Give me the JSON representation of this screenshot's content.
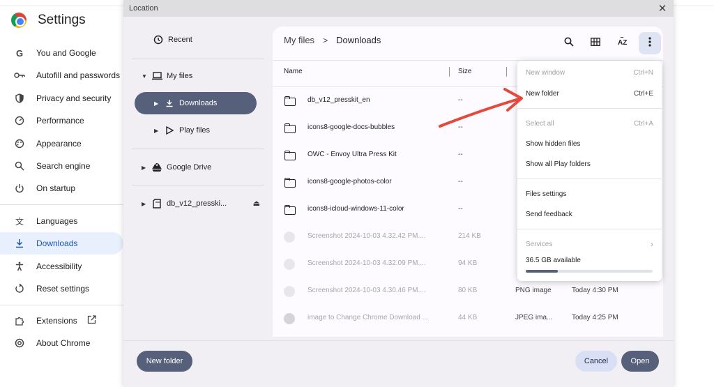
{
  "settings": {
    "title": "Settings",
    "nav": [
      {
        "label": "You and Google",
        "icon": "google-g-icon"
      },
      {
        "label": "Autofill and passwords",
        "icon": "key-icon"
      },
      {
        "label": "Privacy and security",
        "icon": "shield-icon"
      },
      {
        "label": "Performance",
        "icon": "speedometer-icon"
      },
      {
        "label": "Appearance",
        "icon": "palette-icon"
      },
      {
        "label": "Search engine",
        "icon": "search-icon"
      },
      {
        "label": "On startup",
        "icon": "power-icon"
      },
      {
        "label": "Languages",
        "icon": "translate-icon"
      },
      {
        "label": "Downloads",
        "icon": "download-icon"
      },
      {
        "label": "Accessibility",
        "icon": "accessibility-icon"
      },
      {
        "label": "Reset settings",
        "icon": "reset-icon"
      },
      {
        "label": "Extensions",
        "icon": "puzzle-icon"
      },
      {
        "label": "About Chrome",
        "icon": "chrome-icon"
      }
    ],
    "active_item": "Downloads"
  },
  "dialog": {
    "title": "Location",
    "sidebar": {
      "recent": "Recent",
      "my_files": "My files",
      "downloads": "Downloads",
      "play_files": "Play files",
      "google_drive": "Google Drive",
      "usb_drive": "db_v12_presski..."
    },
    "breadcrumb": {
      "root": "My files",
      "separator": ">",
      "current": "Downloads"
    },
    "columns": {
      "name": "Name",
      "size": "Size"
    },
    "files": [
      {
        "name": "db_v12_presskit_en",
        "size": "--",
        "type": "",
        "date": "",
        "kind": "folder"
      },
      {
        "name": "icons8-google-docs-bubbles",
        "size": "--",
        "type": "",
        "date": "",
        "kind": "folder"
      },
      {
        "name": "OWC - Envoy Ultra Press Kit",
        "size": "--",
        "type": "",
        "date": "",
        "kind": "folder"
      },
      {
        "name": "icons8-google-photos-color",
        "size": "--",
        "type": "",
        "date": "",
        "kind": "folder"
      },
      {
        "name": "icons8-icloud-windows-11-color",
        "size": "--",
        "type": "",
        "date": "",
        "kind": "folder"
      },
      {
        "name": "Screenshot 2024-10-03 4.32.42 PM....",
        "size": "214 KB",
        "type": "",
        "date": "",
        "kind": "file"
      },
      {
        "name": "Screenshot 2024-10-03 4.32.09 PM....",
        "size": "94 KB",
        "type": "",
        "date": "",
        "kind": "file"
      },
      {
        "name": "Screenshot 2024-10-03 4.30.46 PM....",
        "size": "80 KB",
        "type": "PNG image",
        "date": "Today 4:30 PM",
        "kind": "file"
      },
      {
        "name": "image to Change Chrome Download ...",
        "size": "44 KB",
        "type": "JPEG ima...",
        "date": "Today 4:25 PM",
        "kind": "file"
      }
    ],
    "buttons": {
      "new_folder": "New folder",
      "cancel": "Cancel",
      "open": "Open"
    },
    "menu": {
      "new_window": "New window",
      "new_window_sc": "Ctrl+N",
      "new_folder": "New folder",
      "new_folder_sc": "Ctrl+E",
      "select_all": "Select all",
      "select_all_sc": "Ctrl+A",
      "show_hidden": "Show hidden files",
      "show_play": "Show all Play folders",
      "files_settings": "Files settings",
      "send_feedback": "Send feedback",
      "services": "Services",
      "storage": "36.5 GB available",
      "storage_used_fraction": 0.25
    }
  },
  "colors": {
    "accent": "#56607a",
    "annotation": "#e5483c",
    "active_nav_bg": "#e8f0fe"
  }
}
